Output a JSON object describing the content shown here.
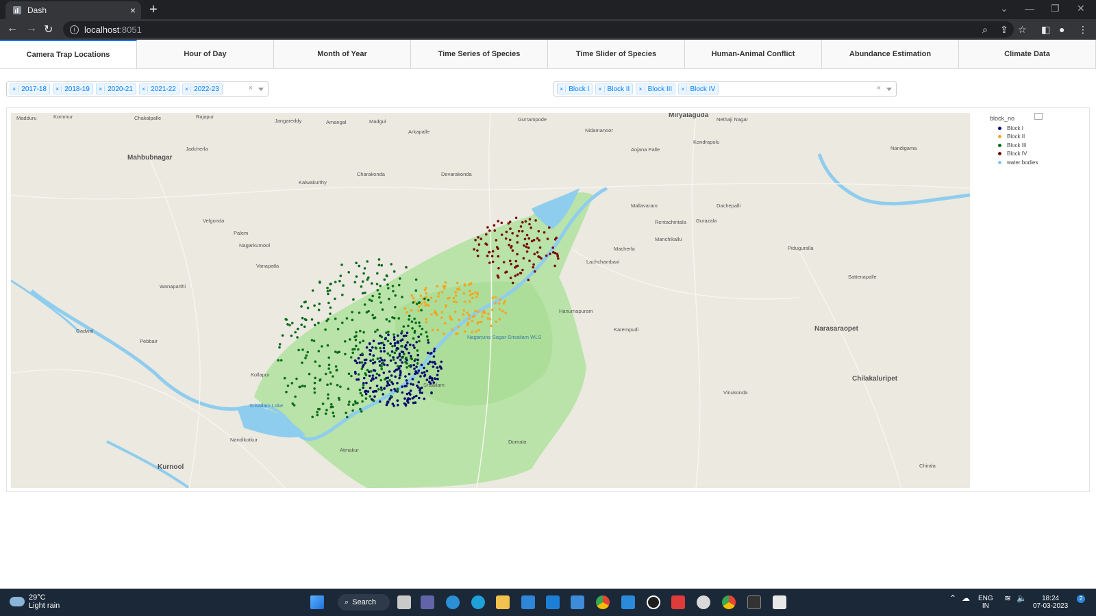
{
  "browser": {
    "tab_title": "Dash",
    "tab_close": "×",
    "new_tab": "+",
    "url_host": "localhost",
    "url_port": ":8051"
  },
  "dash_tabs": [
    {
      "label": "Camera Trap Locations",
      "active": true
    },
    {
      "label": "Hour of Day",
      "active": false
    },
    {
      "label": "Month of Year",
      "active": false
    },
    {
      "label": "Time Series of Species",
      "active": false
    },
    {
      "label": "Time Slider of Species",
      "active": false
    },
    {
      "label": "Human-Animal Conflict",
      "active": false
    },
    {
      "label": "Abundance Estimation",
      "active": false
    },
    {
      "label": "Climate Data",
      "active": false
    }
  ],
  "year_filter": {
    "selected": [
      "2017-18",
      "2018-19",
      "2020-21",
      "2021-22",
      "2022-23"
    ],
    "clear": "×"
  },
  "block_filter": {
    "selected": [
      "Block I",
      "Block II",
      "Block III",
      "Block IV"
    ],
    "clear": "×"
  },
  "chart_data": {
    "type": "scatter",
    "legend_title": "block_no",
    "legend_position": "top-right",
    "series": [
      {
        "name": "Block I",
        "color": "#0b0b6e"
      },
      {
        "name": "Block II",
        "color": "#f5a623"
      },
      {
        "name": "Block III",
        "color": "#0a6b1a"
      },
      {
        "name": "Block IV",
        "color": "#7a0a0a"
      },
      {
        "name": "water bodies",
        "color": "#7ec8f0"
      }
    ]
  },
  "map_labels": [
    "Madduru",
    "Kommur",
    "Chakalpalle",
    "Rajapur",
    "Jangareddy",
    "Amangal",
    "Madgul",
    "Arkapalle",
    "Gurrampode",
    "Miryalaguda",
    "Nethaji Nagar",
    "Mahbubnagar",
    "Jadcherla",
    "Kalwakurthy",
    "Charakonda",
    "Devarakonda",
    "Nidamanoor",
    "Anjana Palle",
    "Kondrapolu",
    "Velgonda",
    "Palem",
    "Nagarkurnool",
    "Vanapatla",
    "Wanaparthi",
    "Gadwal",
    "Pebbair",
    "Kollapur",
    "Srisailam",
    "Macherla",
    "Lachchambavi",
    "Hanumapuram",
    "Karempudi",
    "Vinukonda",
    "Piduguralla",
    "Narasaraopet",
    "Chilakaluripet",
    "Sattenapalle",
    "Kurnool",
    "Dornala",
    "Nandikotkur",
    "Atmakur",
    "Srisailam Lake",
    "Nagarjuna Sagar-Srisailam WLS",
    "Manchikallu",
    "Rentachintala",
    "Dachepalli",
    "Mallavaram",
    "Gurazala",
    "Nandigama",
    "Chirala"
  ],
  "weather": {
    "temp": "29°C",
    "desc": "Light rain"
  },
  "taskbar": {
    "search_label": "Search",
    "lang1": "ENG",
    "lang2": "IN",
    "time": "18:24",
    "date": "07-03-2023",
    "notif": "2"
  }
}
